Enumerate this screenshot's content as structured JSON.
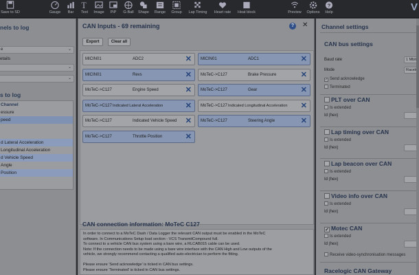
{
  "toolbar": {
    "items": [
      {
        "label": "Save to SD",
        "icon": "save-icon"
      },
      {
        "label": "Gauge",
        "icon": "gauge-icon"
      },
      {
        "label": "Bar",
        "icon": "bar-icon"
      },
      {
        "label": "Text",
        "icon": "text-icon"
      },
      {
        "label": "Image",
        "icon": "image-icon"
      },
      {
        "label": "PiP",
        "icon": "pip-icon"
      },
      {
        "label": "G-Ball",
        "icon": "gball-icon"
      },
      {
        "label": "Shape",
        "icon": "shape-icon"
      },
      {
        "label": "Range",
        "icon": "range-icon"
      },
      {
        "label": "Group",
        "icon": "group-icon"
      },
      {
        "label": "Lap Timing",
        "icon": "lap-timing-icon"
      },
      {
        "label": "Heart rate",
        "icon": "heart-rate-icon"
      },
      {
        "label": "Heat block",
        "icon": "heat-block-icon"
      },
      {
        "label": "Preview",
        "icon": "preview-icon"
      },
      {
        "label": "Options",
        "icon": "options-icon"
      },
      {
        "label": "Help",
        "icon": "help-icon"
      }
    ],
    "logo": "V"
  },
  "left": {
    "title1": "nels to log",
    "dd1": "e",
    "txt1": "etails",
    "dd2": "",
    "dd3": "",
    "title2": "s to log",
    "channels": [
      {
        "text": "Channel",
        "style": "hdr"
      },
      {
        "text": "essure",
        "style": ""
      },
      {
        "text": "peed",
        "style": "sel"
      },
      {
        "text": "",
        "style": ""
      },
      {
        "text": "",
        "style": ""
      },
      {
        "text": "d Lateral Acceleration",
        "style": "hl"
      },
      {
        "text": "Longitudinal Acceleration",
        "style": ""
      },
      {
        "text": "d Vehicle Speed",
        "style": "hl"
      },
      {
        "text": "Angle",
        "style": ""
      },
      {
        "text": "Position",
        "style": "hl"
      }
    ]
  },
  "center": {
    "title": "CAN Inputs  -  69 remaining",
    "help": "?",
    "close": "✕",
    "export_label": "Export",
    "clear_label": "Clear all",
    "items": [
      {
        "src": "MICIN01",
        "name": "ADC2",
        "sel": false
      },
      {
        "src": "MICIN01",
        "name": "ADC1",
        "sel": true
      },
      {
        "src": "MICIN01",
        "name": "Revs",
        "sel": true
      },
      {
        "src": "MoTeC->C127",
        "name": "Brake Pressure",
        "sel": false
      },
      {
        "src": "MoTeC->C127",
        "name": "Engine Speed",
        "sel": false
      },
      {
        "src": "MoTeC->C127",
        "name": "Gear",
        "sel": true
      },
      {
        "src": "MoTeC->C127",
        "name": "Indicated Lateral Acceleration",
        "sel": true
      },
      {
        "src": "MoTeC->C127",
        "name": "Indicated Longitudinal Acceleration",
        "sel": false
      },
      {
        "src": "MoTeC->C127",
        "name": "Indicated Vehicle Speed",
        "sel": false
      },
      {
        "src": "MoTeC->C127",
        "name": "Steering Angle",
        "sel": true
      },
      {
        "src": "MoTeC->C127",
        "name": "Throttle Position",
        "sel": true
      }
    ],
    "info_title": "CAN connection information: MoTeC C127",
    "info_lines": [
      "In order to connect to a MoTeC Dash / Data Logger the relevant CAN output must be enabled in the MoTeC",
      "software. In Communications Setup load section - VCS TransmitCompound full.",
      "To connect to a vehicle CAN bus system using a bare wire, a RLCAB015 cable can be used.",
      "Note: If the connection needs to be made using a bare wire interface with the CAN High and Low outputs of the",
      "vehicle, we strongly recommend contacting a qualified auto-electrician to perform the fitting.",
      "",
      "Please ensure 'Send acknowledge' is ticked in CAN bus settings.",
      "Please ensure 'Terminated' is ticked in CAN bus settings."
    ]
  },
  "right": {
    "title": "Channel settings",
    "bus_title": "CAN bus settings",
    "baud_label": "Baud rate",
    "baud_value": "1 Mbit",
    "mode_label": "Mode",
    "mode_value": "Racelo",
    "send_ack": "Send acknowledge",
    "terminated": "Terminated",
    "sections": [
      {
        "title": "PLT over CAN",
        "checked": false,
        "ext": "Is extended",
        "id": "Id (hex)"
      },
      {
        "title": "Lap timing over CAN",
        "checked": false,
        "ext": "Is extended",
        "id": "Id (hex)"
      },
      {
        "title": "Lap beacon over CAN",
        "checked": false,
        "ext": "Is extended",
        "id": "Id (hex)"
      },
      {
        "title": "Video info over CAN",
        "checked": false,
        "ext": "Is extended",
        "id": "Id (hex)"
      },
      {
        "title": "Motec CAN",
        "checked": true,
        "ext": "Is extended",
        "id": "Id (hex)"
      }
    ],
    "vsync": "Receive video-synchronisation messages",
    "gateway": "Racelogic CAN Gateway"
  }
}
